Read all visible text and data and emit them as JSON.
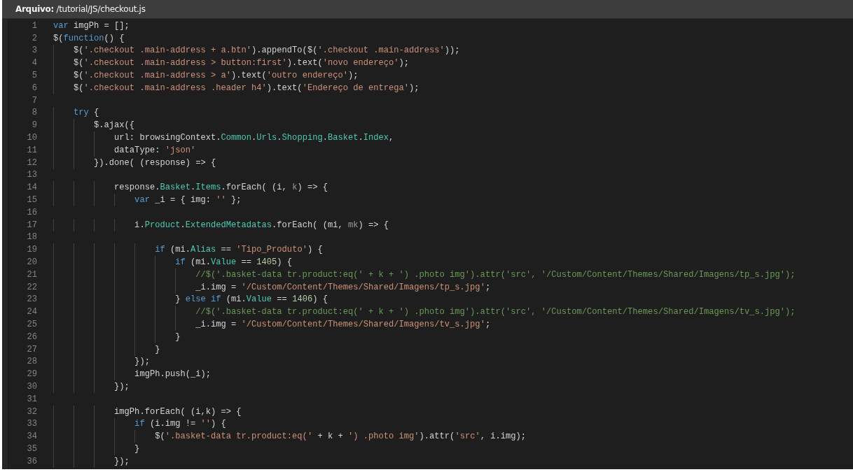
{
  "file_header": "**Arquivo:** /tutorial/JS/checkout.js",
  "lines": [
    {
      "number": "1",
      "tokens": [
        {
          "text": "var",
          "kind": "keyword"
        },
        {
          "text": " imgPh = [];",
          "kind": "plain"
        }
      ]
    },
    {
      "number": "2",
      "tokens": [
        {
          "text": "$(",
          "kind": "plain"
        },
        {
          "text": "function",
          "kind": "keyword"
        },
        {
          "text": "() {",
          "kind": "plain"
        }
      ]
    },
    {
      "number": "3",
      "tokens": [
        {
          "text": "    $(",
          "kind": "plain"
        },
        {
          "text": "'.checkout .main-address + a.btn'",
          "kind": "string"
        },
        {
          "text": ").appendTo($(",
          "kind": "plain"
        },
        {
          "text": "'.checkout .main-address'",
          "kind": "string"
        },
        {
          "text": "));",
          "kind": "plain"
        }
      ]
    },
    {
      "number": "4",
      "tokens": [
        {
          "text": "    $(",
          "kind": "plain"
        },
        {
          "text": "'.checkout .main-address > button:first'",
          "kind": "string"
        },
        {
          "text": ").text(",
          "kind": "plain"
        },
        {
          "text": "'novo endereço'",
          "kind": "string"
        },
        {
          "text": ");",
          "kind": "plain"
        }
      ]
    },
    {
      "number": "5",
      "tokens": [
        {
          "text": "    $(",
          "kind": "plain"
        },
        {
          "text": "'.checkout .main-address > a'",
          "kind": "string"
        },
        {
          "text": ").text(",
          "kind": "plain"
        },
        {
          "text": "'outro endereço'",
          "kind": "string"
        },
        {
          "text": ");",
          "kind": "plain"
        }
      ]
    },
    {
      "number": "6",
      "tokens": [
        {
          "text": "    $(",
          "kind": "plain"
        },
        {
          "text": "'.checkout .main-address .header h4'",
          "kind": "string"
        },
        {
          "text": ").text(",
          "kind": "plain"
        },
        {
          "text": "'Endereço de entrega'",
          "kind": "string"
        },
        {
          "text": ");",
          "kind": "plain"
        }
      ]
    },
    {
      "number": "7"
    },
    {
      "number": "8",
      "tokens": [
        {
          "text": "    try",
          "kind": "keyword"
        },
        {
          "text": " {",
          "kind": "plain"
        }
      ]
    },
    {
      "number": "9",
      "tokens": [
        {
          "text": "        $.ajax({",
          "kind": "plain"
        }
      ]
    },
    {
      "number": "10",
      "tokens": [
        {
          "text": "            url: browsingContext.",
          "kind": "plain"
        },
        {
          "text": "Common",
          "kind": "property"
        },
        {
          "text": ".",
          "kind": "plain"
        },
        {
          "text": "Urls",
          "kind": "property"
        },
        {
          "text": ".",
          "kind": "plain"
        },
        {
          "text": "Shopping",
          "kind": "property"
        },
        {
          "text": ".",
          "kind": "plain"
        },
        {
          "text": "Basket",
          "kind": "property"
        },
        {
          "text": ".",
          "kind": "plain"
        },
        {
          "text": "Index",
          "kind": "property"
        },
        {
          "text": ",",
          "kind": "plain"
        }
      ]
    },
    {
      "number": "11",
      "tokens": [
        {
          "text": "            dataType: ",
          "kind": "plain"
        },
        {
          "text": "'json'",
          "kind": "string"
        }
      ]
    },
    {
      "number": "12",
      "tokens": [
        {
          "text": "        }).done( (response) => {",
          "kind": "plain"
        }
      ]
    },
    {
      "number": "13"
    },
    {
      "number": "14",
      "tokens": [
        {
          "text": "            response.",
          "kind": "plain"
        },
        {
          "text": "Basket",
          "kind": "property"
        },
        {
          "text": ".",
          "kind": "plain"
        },
        {
          "text": "Items",
          "kind": "property"
        },
        {
          "text": ".forEach( (i, ",
          "kind": "plain"
        },
        {
          "text": "k",
          "kind": "unused"
        },
        {
          "text": ") => {",
          "kind": "plain"
        }
      ]
    },
    {
      "number": "15",
      "tokens": [
        {
          "text": "                var",
          "kind": "keyword"
        },
        {
          "text": " _i = { img: ",
          "kind": "plain"
        },
        {
          "text": "''",
          "kind": "string"
        },
        {
          "text": " };",
          "kind": "plain"
        }
      ]
    },
    {
      "number": "16"
    },
    {
      "number": "17",
      "tokens": [
        {
          "text": "                i.",
          "kind": "plain"
        },
        {
          "text": "Product",
          "kind": "property"
        },
        {
          "text": ".",
          "kind": "plain"
        },
        {
          "text": "ExtendedMetadatas",
          "kind": "property"
        },
        {
          "text": ".forEach( (mi, ",
          "kind": "plain"
        },
        {
          "text": "mk",
          "kind": "unused"
        },
        {
          "text": ") => {",
          "kind": "plain"
        }
      ]
    },
    {
      "number": "18"
    },
    {
      "number": "19",
      "tokens": [
        {
          "text": "                    if",
          "kind": "keyword"
        },
        {
          "text": " (mi.",
          "kind": "plain"
        },
        {
          "text": "Alias",
          "kind": "property"
        },
        {
          "text": " == ",
          "kind": "plain"
        },
        {
          "text": "'Tipo_Produto'",
          "kind": "string"
        },
        {
          "text": ") {",
          "kind": "plain"
        }
      ]
    },
    {
      "number": "20",
      "tokens": [
        {
          "text": "                        if",
          "kind": "keyword"
        },
        {
          "text": " (mi.",
          "kind": "plain"
        },
        {
          "text": "Value",
          "kind": "property"
        },
        {
          "text": " == ",
          "kind": "plain"
        },
        {
          "text": "1405",
          "kind": "number"
        },
        {
          "text": ") {",
          "kind": "plain"
        }
      ]
    },
    {
      "number": "21",
      "tokens": [
        {
          "text": "                            //$('.basket-data tr.product:eq(' + k + ') .photo img').attr('src', '/Custom/Content/Themes/Shared/Imagens/tp_s.jpg');",
          "kind": "comment"
        }
      ]
    },
    {
      "number": "22",
      "tokens": [
        {
          "text": "                            _i.img = ",
          "kind": "plain"
        },
        {
          "text": "'/Custom/Content/Themes/Shared/Imagens/tp_s.jpg'",
          "kind": "string"
        },
        {
          "text": ";",
          "kind": "plain"
        }
      ]
    },
    {
      "number": "23",
      "tokens": [
        {
          "text": "                        } ",
          "kind": "plain"
        },
        {
          "text": "else if",
          "kind": "keyword"
        },
        {
          "text": " (mi.",
          "kind": "plain"
        },
        {
          "text": "Value",
          "kind": "property"
        },
        {
          "text": " == ",
          "kind": "plain"
        },
        {
          "text": "1406",
          "kind": "number"
        },
        {
          "text": ") {",
          "kind": "plain"
        }
      ]
    },
    {
      "number": "24",
      "tokens": [
        {
          "text": "                            //$('.basket-data tr.product:eq(' + k + ') .photo img').attr('src', '/Custom/Content/Themes/Shared/Imagens/tv_s.jpg');",
          "kind": "comment"
        }
      ]
    },
    {
      "number": "25",
      "tokens": [
        {
          "text": "                            _i.img = ",
          "kind": "plain"
        },
        {
          "text": "'/Custom/Content/Themes/Shared/Imagens/tv_s.jpg'",
          "kind": "string"
        },
        {
          "text": ";",
          "kind": "plain"
        }
      ]
    },
    {
      "number": "26",
      "tokens": [
        {
          "text": "                        }",
          "kind": "plain"
        }
      ]
    },
    {
      "number": "27",
      "tokens": [
        {
          "text": "                    }",
          "kind": "plain"
        }
      ]
    },
    {
      "number": "28",
      "tokens": [
        {
          "text": "                });",
          "kind": "plain"
        }
      ]
    },
    {
      "number": "29",
      "tokens": [
        {
          "text": "                imgPh.push(_i);",
          "kind": "plain"
        }
      ]
    },
    {
      "number": "30",
      "tokens": [
        {
          "text": "            });",
          "kind": "plain"
        }
      ]
    },
    {
      "number": "31"
    },
    {
      "number": "32",
      "tokens": [
        {
          "text": "            imgPh.forEach( (i,k) => {",
          "kind": "plain"
        }
      ]
    },
    {
      "number": "33",
      "tokens": [
        {
          "text": "                if",
          "kind": "keyword"
        },
        {
          "text": " (i.img != ",
          "kind": "plain"
        },
        {
          "text": "''",
          "kind": "string"
        },
        {
          "text": ") {",
          "kind": "plain"
        }
      ]
    },
    {
      "number": "34",
      "tokens": [
        {
          "text": "                    $(",
          "kind": "plain"
        },
        {
          "text": "'.basket-data tr.product:eq('",
          "kind": "string"
        },
        {
          "text": " + k + ",
          "kind": "plain"
        },
        {
          "text": "') .photo img'",
          "kind": "string"
        },
        {
          "text": ").attr(",
          "kind": "plain"
        },
        {
          "text": "'src'",
          "kind": "string"
        },
        {
          "text": ", i.img);",
          "kind": "plain"
        }
      ]
    },
    {
      "number": "35",
      "tokens": [
        {
          "text": "                }",
          "kind": "plain"
        }
      ]
    },
    {
      "number": "36",
      "tokens": [
        {
          "text": "            });",
          "kind": "plain"
        }
      ]
    }
  ]
}
